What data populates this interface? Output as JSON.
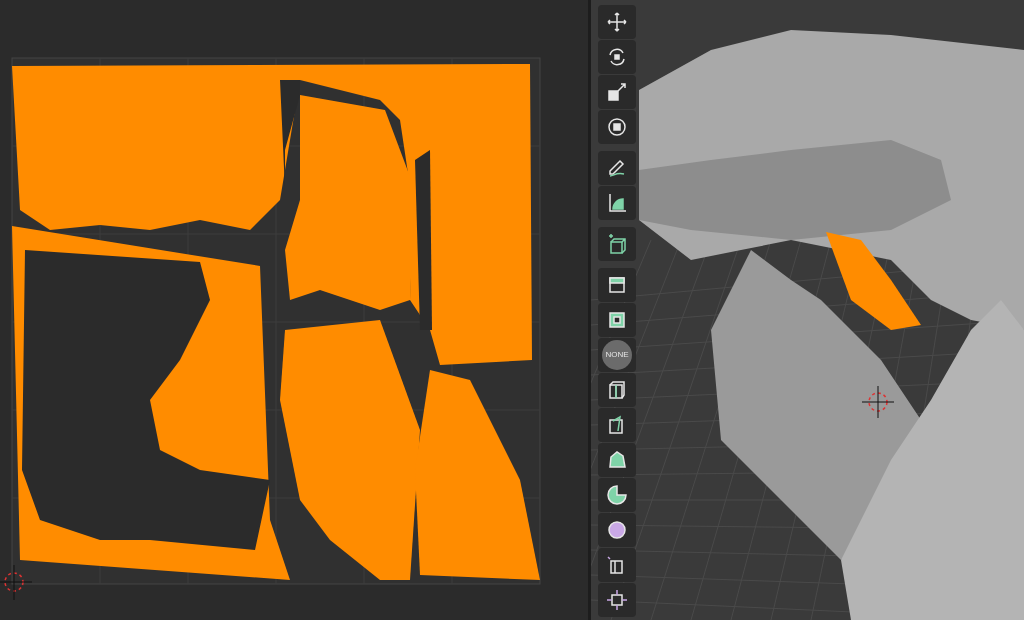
{
  "viewport_toolbar": {
    "none_tool": {
      "label": "NONE"
    }
  }
}
